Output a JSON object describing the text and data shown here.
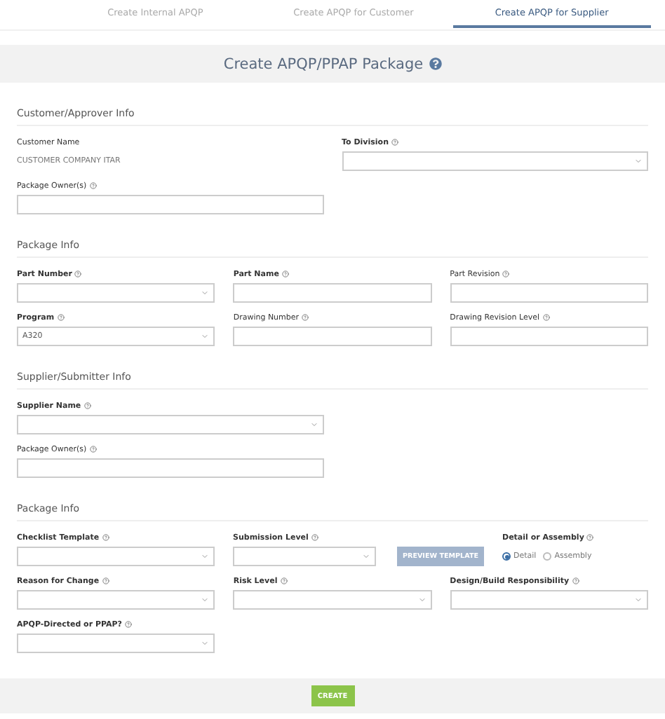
{
  "tabs": [
    {
      "label": "Create Internal APQP",
      "selected": false
    },
    {
      "label": "Create APQP for Customer",
      "selected": false
    },
    {
      "label": "Create APQP for Supplier",
      "selected": true
    }
  ],
  "title": "Create APQP/PPAP Package",
  "sections": [
    {
      "title": "Customer/Approver Info",
      "kind": "two_column",
      "rows": [
        [
          {
            "kind": "static",
            "label": "Customer Name",
            "required": false,
            "help": false,
            "value": "CUSTOMER COMPANY ITAR"
          },
          {
            "kind": "select",
            "label": "To Division",
            "required": true,
            "help": true
          }
        ],
        [
          {
            "kind": "text",
            "label": "Package Owner(s)",
            "required": false,
            "help": true
          }
        ]
      ]
    },
    {
      "title": "Package Info",
      "kind": "three_column",
      "rows": [
        [
          {
            "kind": "select",
            "label": "Part Number",
            "required": true,
            "help": true
          },
          {
            "kind": "text",
            "label": "Part Name",
            "required": true,
            "help": true
          },
          {
            "kind": "text",
            "label": "Part Revision",
            "required": false,
            "help": true
          }
        ],
        [
          {
            "kind": "select",
            "label": "Program",
            "required": true,
            "help": true,
            "value": "A320"
          },
          {
            "kind": "text",
            "label": "Drawing Number",
            "required": false,
            "help": true
          },
          {
            "kind": "text",
            "label": "Drawing Revision Level",
            "required": false,
            "help": true
          }
        ]
      ]
    },
    {
      "title": "Supplier/Submitter Info",
      "kind": "two_column",
      "rows": [
        [
          {
            "kind": "select",
            "label": "Supplier Name",
            "required": true,
            "help": true
          }
        ],
        [
          {
            "kind": "text",
            "label": "Package Owner(s)",
            "required": false,
            "help": true
          }
        ]
      ]
    },
    {
      "title": "Package Info",
      "kind": "three_column",
      "rows": [
        [
          {
            "kind": "select",
            "label": "Checklist Template",
            "required": true,
            "help": true
          },
          {
            "kind": "select",
            "label": "Submission Level",
            "required": true,
            "help": true,
            "button": "PREVIEW TEMPLATE"
          },
          {
            "kind": "radio",
            "label": "Detail or Assembly",
            "required": true,
            "help": true,
            "options": [
              {
                "label": "Detail",
                "selected": true
              },
              {
                "label": "Assembly",
                "selected": false
              }
            ]
          }
        ],
        [
          {
            "kind": "select",
            "label": "Reason for Change",
            "required": true,
            "help": true
          },
          {
            "kind": "select",
            "label": "Risk Level",
            "required": true,
            "help": true
          },
          {
            "kind": "select",
            "label": "Design/Build Responsibility",
            "required": true,
            "help": true
          }
        ],
        [
          {
            "kind": "select",
            "label": "APQP-Directed or PPAP?",
            "required": true,
            "help": true
          }
        ]
      ]
    }
  ],
  "submit": "CREATE"
}
